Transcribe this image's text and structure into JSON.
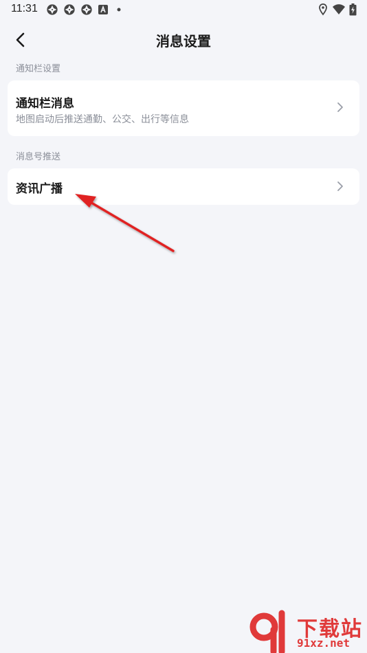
{
  "status_bar": {
    "time": "11:31",
    "notification_icons": [
      "aperture-icon",
      "aperture-icon",
      "aperture-icon",
      "a-box-icon",
      "dot-icon"
    ],
    "right_icons": [
      "location-icon",
      "wifi-icon",
      "battery-charging-icon"
    ]
  },
  "header": {
    "title": "消息设置",
    "back_icon": "chevron-left-icon"
  },
  "sections": [
    {
      "label": "通知栏设置",
      "items": [
        {
          "title": "通知栏消息",
          "subtitle": "地图启动后推送通勤、公交、出行等信息"
        }
      ]
    },
    {
      "label": "消息号推送",
      "items": [
        {
          "title": "资讯广播"
        }
      ]
    }
  ],
  "annotation": {
    "color": "#e02424"
  },
  "watermark": {
    "text": "下载站",
    "url": "91xz.net",
    "color": "#e03a3a"
  }
}
